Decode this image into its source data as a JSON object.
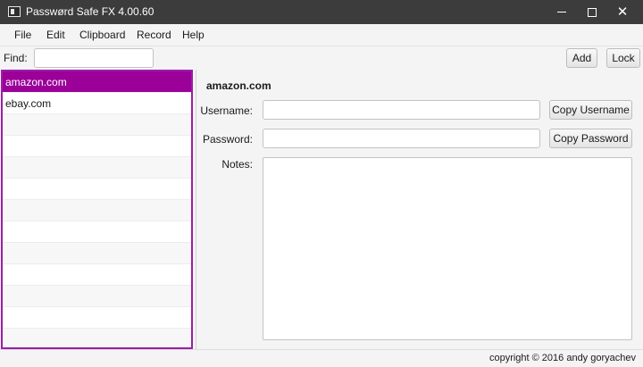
{
  "window": {
    "title": "Passwørd Safe FX 4.00.60",
    "close_glyph": "✕"
  },
  "menu": [
    "File",
    "Edit",
    "Clipboard",
    "Record",
    "Help"
  ],
  "toolbar": {
    "find_label": "Find:",
    "find_value": "",
    "add_label": "Add",
    "lock_label": "Lock"
  },
  "records": [
    {
      "label": "amazon.com",
      "selected": true
    },
    {
      "label": "ebay.com",
      "selected": false
    }
  ],
  "detail": {
    "title": "amazon.com",
    "username_label": "Username:",
    "username_value": "",
    "password_label": "Password:",
    "password_value": "",
    "notes_label": "Notes:",
    "notes_value": "",
    "copy_username_label": "Copy Username",
    "copy_password_label": "Copy Password"
  },
  "status": {
    "copyright": "copyright © 2016 andy goryachev"
  },
  "colors": {
    "selection": "#9b0098",
    "list_border": "#9b1ea6",
    "titlebar": "#3c3c3c"
  }
}
